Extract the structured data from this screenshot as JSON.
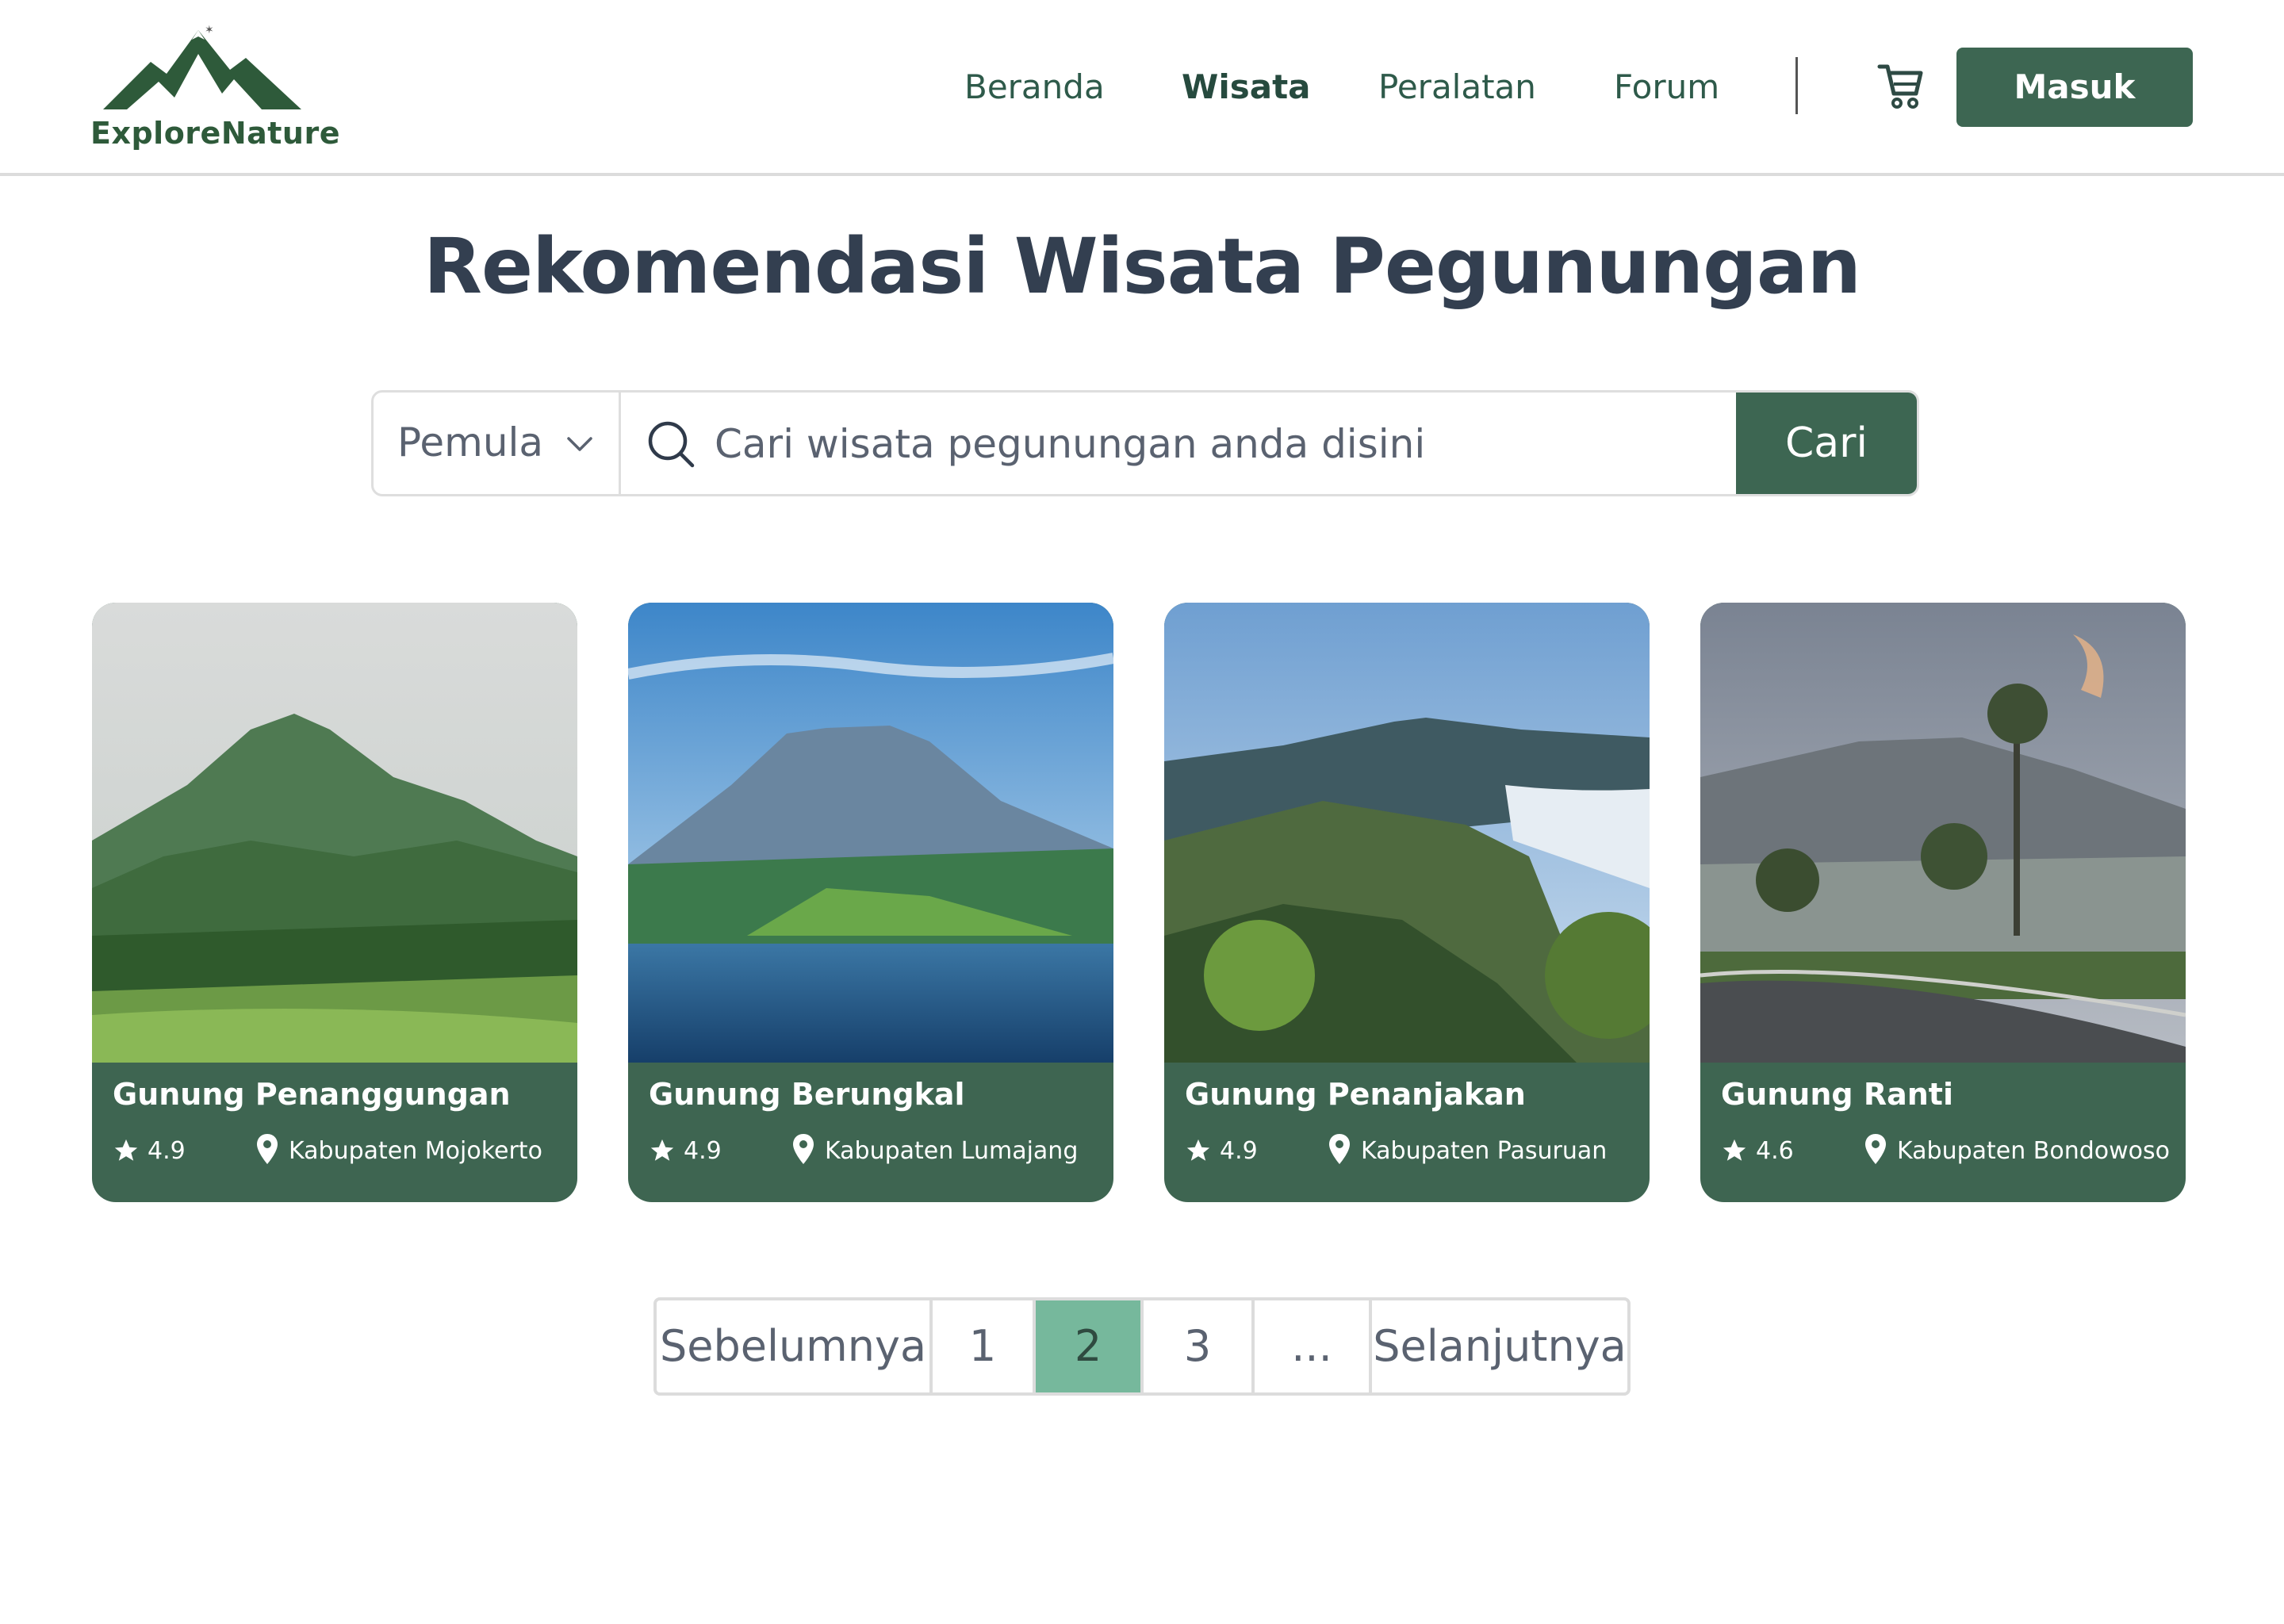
{
  "brand": {
    "name": "ExploreNature",
    "logo_icon": "mountain-logo"
  },
  "nav": {
    "items": [
      {
        "label": "Beranda",
        "active": false
      },
      {
        "label": "Wisata",
        "active": true
      },
      {
        "label": "Peralatan",
        "active": false
      },
      {
        "label": "Forum",
        "active": false
      }
    ],
    "cart_icon": "cart-icon",
    "login_label": "Masuk"
  },
  "page": {
    "title": "Rekomendasi Wisata Pegunungan"
  },
  "search": {
    "level_selected": "Pemula",
    "placeholder": "Cari wisata pegunungan anda disini",
    "button_label": "Cari"
  },
  "cards": [
    {
      "name": "Gunung Penanggungan",
      "rating": "4.9",
      "location": "Kabupaten Mojokerto"
    },
    {
      "name": "Gunung Berungkal",
      "rating": "4.9",
      "location": "Kabupaten Lumajang"
    },
    {
      "name": "Gunung Penanjakan",
      "rating": "4.9",
      "location": "Kabupaten Pasuruan"
    },
    {
      "name": "Gunung Ranti",
      "rating": "4.6",
      "location": "Kabupaten Bondowoso"
    }
  ],
  "pagination": {
    "prev_label": "Sebelumnya",
    "pages": [
      "1",
      "2",
      "3",
      "..."
    ],
    "current_page": "2",
    "next_label": "Selanjutnya"
  },
  "colors": {
    "accent": "#3d6652",
    "card_bg": "#3e6551",
    "active_page": "#76b89c",
    "title": "#333f50"
  }
}
